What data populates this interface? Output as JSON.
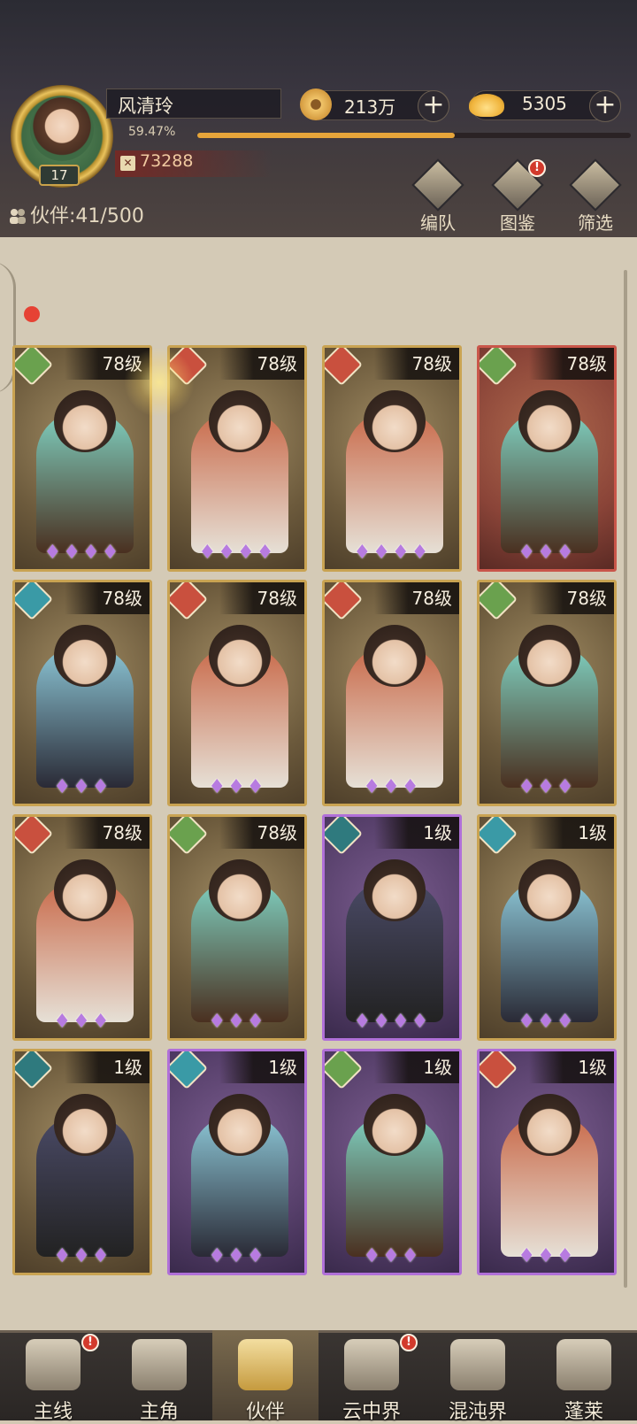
{
  "player": {
    "name": "风清玲",
    "level": "17",
    "exp_percent_text": "59.47%",
    "exp_fraction": 0.5947,
    "power": "73288"
  },
  "currency": {
    "coins": "213万",
    "ingots": "5305",
    "add_symbol": "+"
  },
  "partners": {
    "label": "伙伴:",
    "count": "41/500"
  },
  "toolbar": {
    "team_label": "编队",
    "codex_label": "图鉴",
    "filter_label": "筛选",
    "codex_alert": "!"
  },
  "cards": [
    {
      "level": "78级",
      "element": "wood",
      "frame": "gold",
      "stars": "♦♦♦♦"
    },
    {
      "level": "78级",
      "element": "fire",
      "frame": "gold",
      "stars": "♦♦♦♦"
    },
    {
      "level": "78级",
      "element": "fire",
      "frame": "gold",
      "stars": "♦♦♦♦"
    },
    {
      "level": "78级",
      "element": "wood",
      "frame": "red",
      "stars": "♦♦♦"
    },
    {
      "level": "78级",
      "element": "water",
      "frame": "gold",
      "stars": "♦♦♦"
    },
    {
      "level": "78级",
      "element": "fire",
      "frame": "gold",
      "stars": "♦♦♦"
    },
    {
      "level": "78级",
      "element": "fire",
      "frame": "gold",
      "stars": "♦♦♦"
    },
    {
      "level": "78级",
      "element": "wood",
      "frame": "gold",
      "stars": "♦♦♦"
    },
    {
      "level": "78级",
      "element": "fire",
      "frame": "gold",
      "stars": "♦♦♦"
    },
    {
      "level": "78级",
      "element": "wood",
      "frame": "gold",
      "stars": "♦♦♦"
    },
    {
      "level": "1级",
      "element": "dark",
      "frame": "purple",
      "stars": "♦♦♦♦"
    },
    {
      "level": "1级",
      "element": "water",
      "frame": "gold",
      "stars": "♦♦♦"
    },
    {
      "level": "1级",
      "element": "dark",
      "frame": "gold",
      "stars": "♦♦♦"
    },
    {
      "level": "1级",
      "element": "water",
      "frame": "purple",
      "stars": "♦♦♦"
    },
    {
      "level": "1级",
      "element": "wood",
      "frame": "purple",
      "stars": "♦♦♦"
    },
    {
      "level": "1级",
      "element": "fire",
      "frame": "purple",
      "stars": "♦♦♦"
    }
  ],
  "nav": [
    {
      "label": "主线",
      "alert": "!"
    },
    {
      "label": "主角",
      "alert": ""
    },
    {
      "label": "伙伴",
      "alert": ""
    },
    {
      "label": "云中界",
      "alert": "!"
    },
    {
      "label": "混沌界",
      "alert": ""
    },
    {
      "label": "蓬莱",
      "alert": ""
    }
  ],
  "colors": {
    "accent_gold": "#e6a53a",
    "frame_gold": "#c9a352",
    "frame_purple": "#b070d8",
    "frame_red": "#c9564a",
    "alert_red": "#d23a2c"
  }
}
